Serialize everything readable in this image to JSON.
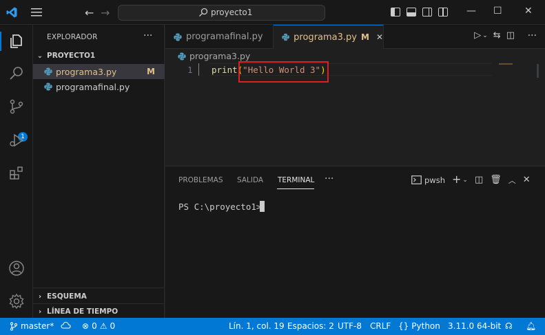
{
  "titlebar": {
    "search_text": "proyecto1"
  },
  "activity": {
    "scm_badge": "1"
  },
  "sidebar": {
    "title": "EXPLORADOR",
    "folder": "PROYECTO1",
    "files": [
      {
        "name": "programa3.py",
        "status": "M"
      },
      {
        "name": "programafinal.py",
        "status": ""
      }
    ],
    "outline": "ESQUEMA",
    "timeline": "LÍNEA DE TIEMPO"
  },
  "tabs": [
    {
      "label": "programafinal.py"
    },
    {
      "label": "programa3.py",
      "status": "M"
    }
  ],
  "editor": {
    "breadcrumb": "programa3.py",
    "line_number": "1",
    "code_fn": "print",
    "code_open": "(",
    "code_string": "\"Hello World 3\"",
    "code_close": ")"
  },
  "panel": {
    "tabs": [
      "PROBLEMAS",
      "SALIDA",
      "TERMINAL"
    ],
    "shell": "pwsh",
    "prompt": "PS C:\\proyecto1> "
  },
  "statusbar": {
    "branch": "master*",
    "errors": "0",
    "warnings": "0",
    "position": "Lín. 1, col. 19",
    "spaces": "Espacios: 2",
    "encoding": "UTF-8",
    "eol": "CRLF",
    "language": "Python",
    "interpreter": "3.11.0 64-bit"
  },
  "colors": {
    "accent": "#0078d4",
    "modified": "#e2c08d",
    "highlight_box": "#e02020"
  }
}
